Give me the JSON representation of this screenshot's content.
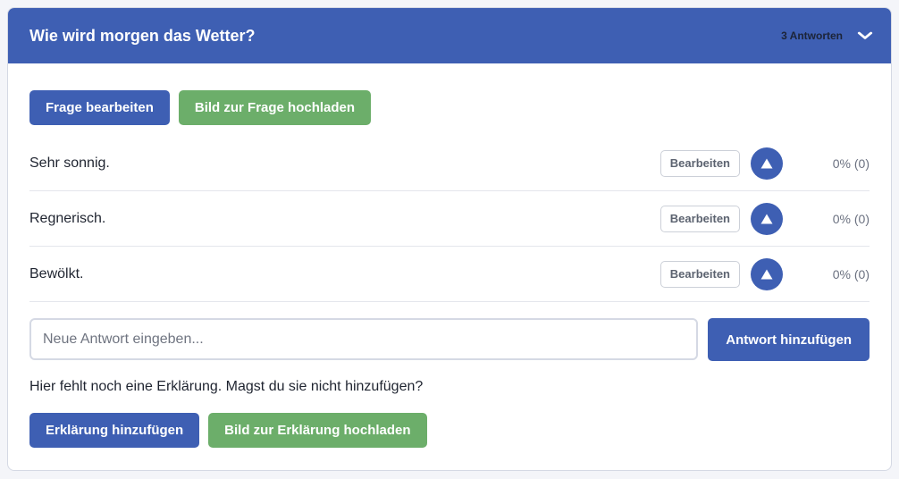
{
  "question": {
    "title": "Wie wird morgen das Wetter?",
    "answer_count": "3 Antworten",
    "collapse_symbol": "❯",
    "edit_label": "Frage bearbeiten",
    "upload_image_label": "Bild zur Frage hochladen"
  },
  "answers": [
    {
      "text": "Sehr sonnig.",
      "edit_label": "Bearbeiten",
      "result": "0% (0)"
    },
    {
      "text": "Regnerisch.",
      "edit_label": "Bearbeiten",
      "result": "0% (0)"
    },
    {
      "text": "Bewölkt.",
      "edit_label": "Bearbeiten",
      "result": "0% (0)"
    }
  ],
  "new_answer": {
    "placeholder": "Neue Antwort eingeben...",
    "value": "",
    "add_label": "Antwort hinzufügen"
  },
  "explanation": {
    "missing_text": "Hier fehlt noch eine Erklärung. Magst du sie nicht hinzufügen?",
    "add_label": "Erklärung hinzufügen",
    "upload_image_label": "Bild zur Erklärung hochladen"
  },
  "colors": {
    "primary": "#3e5fb3",
    "success": "#6cae6a",
    "page_background": "#f4f5f9"
  }
}
